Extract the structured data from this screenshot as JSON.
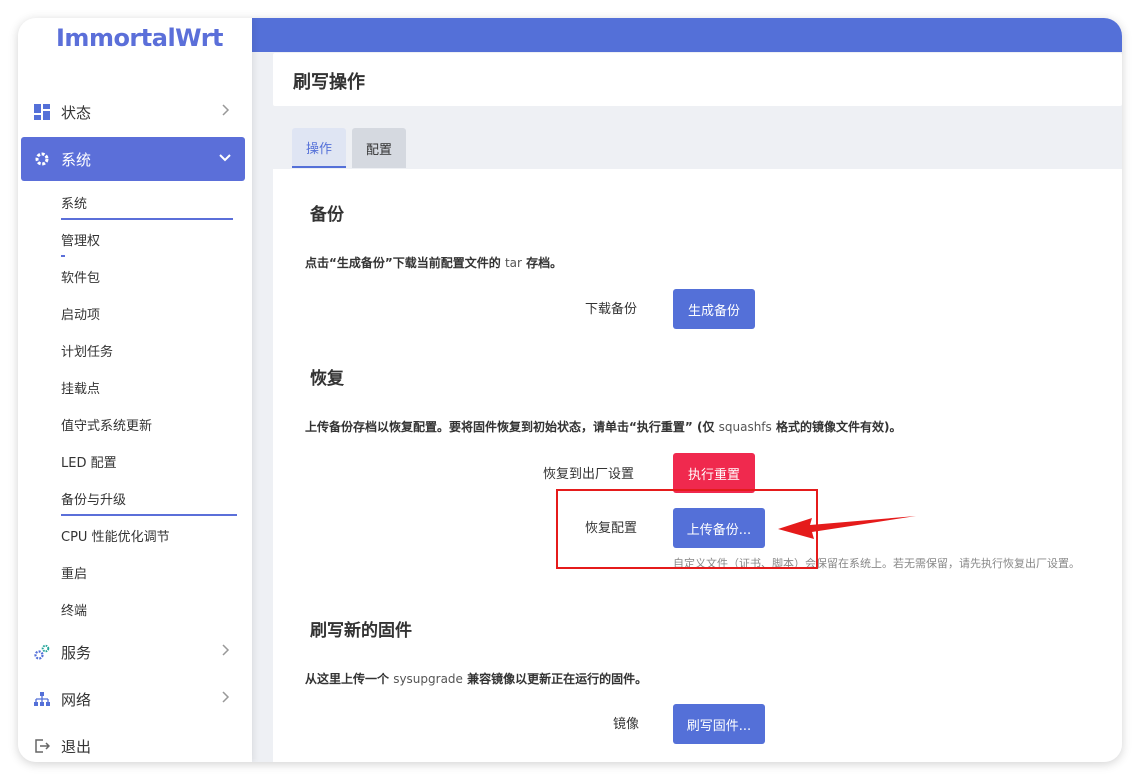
{
  "brand": "ImmortalWrt",
  "sidebar": {
    "items": [
      {
        "label": "状态",
        "icon": "dashboard-icon"
      },
      {
        "label": "系统",
        "icon": "gear-icon",
        "active": true
      },
      {
        "label": "服务",
        "icon": "gears-icon"
      },
      {
        "label": "网络",
        "icon": "network-icon"
      },
      {
        "label": "退出",
        "icon": "logout-icon"
      }
    ],
    "system_sub": [
      "系统",
      "管理权",
      "软件包",
      "启动项",
      "计划任务",
      "挂载点",
      "值守式系统更新",
      "LED 配置",
      "备份与升级",
      "CPU 性能优化调节",
      "重启",
      "终端"
    ]
  },
  "page": {
    "title": "刷写操作",
    "tabs": [
      "操作",
      "配置"
    ]
  },
  "backup": {
    "heading": "备份",
    "desc_pre": "点击“生成备份”下载当前配置文件的 ",
    "desc_tar": "tar",
    "desc_post": " 存档。",
    "download_label": "下载备份",
    "generate_button": "生成备份"
  },
  "restore": {
    "heading": "恢复",
    "desc_pre": "上传备份存档以恢复配置。要将固件恢复到初始状态，请单击“执行重置” (仅 ",
    "desc_squash": "squashfs",
    "desc_post": " 格式的镜像文件有效)。",
    "factory_label": "恢复到出厂设置",
    "reset_button": "执行重置",
    "restore_label": "恢复配置",
    "upload_button": "上传备份...",
    "help": "自定义文件（证书、脚本）会保留在系统上。若无需保留，请先执行恢复出厂设置。"
  },
  "flash": {
    "heading": "刷写新的固件",
    "desc_pre": "从这里上传一个 ",
    "desc_sys": "sysupgrade",
    "desc_post": " 兼容镜像以更新正在运行的固件。",
    "image_label": "镜像",
    "flash_button": "刷写固件..."
  },
  "colors": {
    "accent": "#5470d8",
    "danger": "#f0294e",
    "annotation": "#e51b1b"
  }
}
